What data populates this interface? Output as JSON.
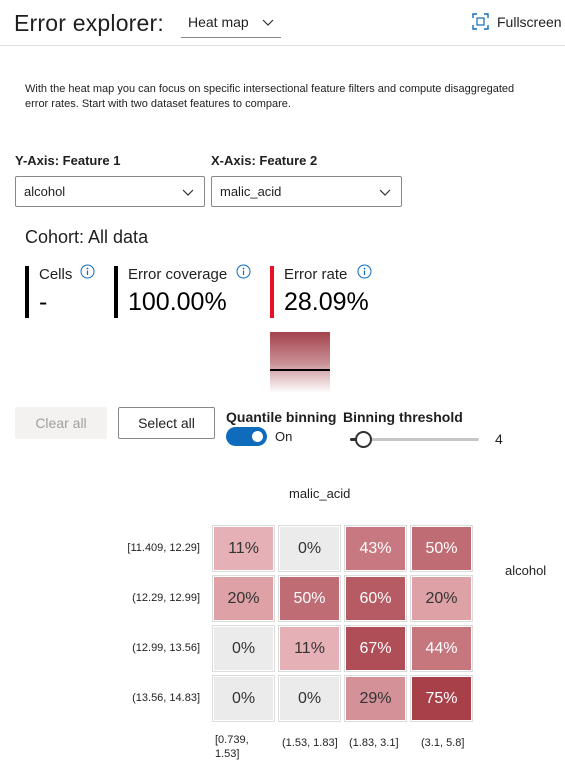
{
  "header": {
    "title": "Error explorer:",
    "view_select": "Heat map",
    "fullscreen_label": "Fullscreen"
  },
  "description": "With the heat map you can focus on specific intersectional feature filters and compute disaggregated error rates. Start with two dataset features to compare.",
  "features": {
    "y_label": "Y-Axis: Feature 1",
    "y_value": "alcohol",
    "x_label": "X-Axis: Feature 2",
    "x_value": "malic_acid"
  },
  "cohort": {
    "title": "Cohort: All data",
    "cells_label": "Cells",
    "cells_value": "-",
    "coverage_label": "Error coverage",
    "coverage_value": "100.00%",
    "rate_label": "Error rate",
    "rate_value": "28.09%"
  },
  "controls": {
    "clear_all": "Clear all",
    "select_all": "Select all",
    "quantile_label": "Quantile binning",
    "quantile_state": "On",
    "binning_label": "Binning threshold",
    "binning_value": "4"
  },
  "colors": {
    "accent": "#0f6cbd",
    "error_rate_bar": "#e81123",
    "heat_dark": "#a3434d",
    "zero_cell": "#ebebeb"
  },
  "heatmap": {
    "x_feature": "malic_acid",
    "y_feature": "alcohol",
    "row_labels": [
      "[11.409, 12.29]",
      "(12.29, 12.99]",
      "(12.99, 13.56]",
      "(13.56, 14.83]"
    ],
    "col_labels": [
      "[0.739, 1.53]",
      "(1.53, 1.83]",
      "(1.83, 3.1]",
      "(3.1, 5.8]"
    ],
    "cells": [
      [
        "11%",
        "0%",
        "43%",
        "50%"
      ],
      [
        "20%",
        "50%",
        "60%",
        "20%"
      ],
      [
        "0%",
        "11%",
        "67%",
        "44%"
      ],
      [
        "0%",
        "0%",
        "29%",
        "75%"
      ]
    ],
    "rates": [
      [
        11,
        0,
        43,
        50
      ],
      [
        20,
        50,
        60,
        20
      ],
      [
        0,
        11,
        67,
        44
      ],
      [
        0,
        0,
        29,
        75
      ]
    ]
  }
}
